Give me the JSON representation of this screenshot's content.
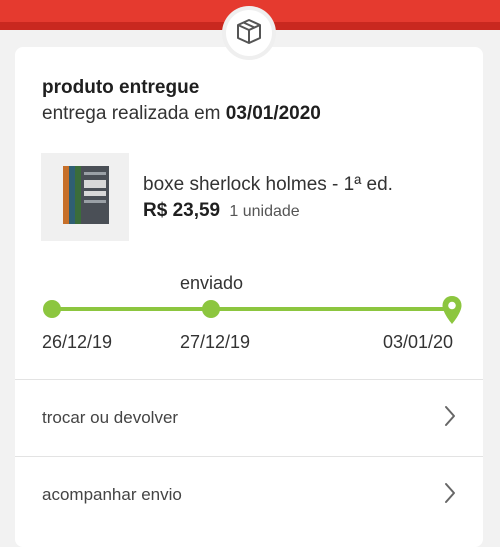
{
  "header": {
    "accent_color": "#e53a2f",
    "icon": "box-icon"
  },
  "order": {
    "status_title": "produto entregue",
    "status_prefix": "entrega realizada em",
    "status_date": "03/01/2020"
  },
  "product": {
    "name": "boxe sherlock holmes - 1ª ed.",
    "price": "R$ 23,59",
    "quantity": "1 unidade",
    "thumbnail_icon": "book-box-icon"
  },
  "timeline": {
    "color": "#8cc63f",
    "middle_label": "enviado",
    "steps": [
      {
        "date": "26/12/19"
      },
      {
        "date": "27/12/19"
      },
      {
        "date": "03/01/20"
      }
    ],
    "progress": 1.0
  },
  "actions": [
    {
      "label": "trocar ou devolver",
      "icon": "chevron-right-icon"
    },
    {
      "label": "acompanhar envio",
      "icon": "chevron-right-icon"
    }
  ]
}
